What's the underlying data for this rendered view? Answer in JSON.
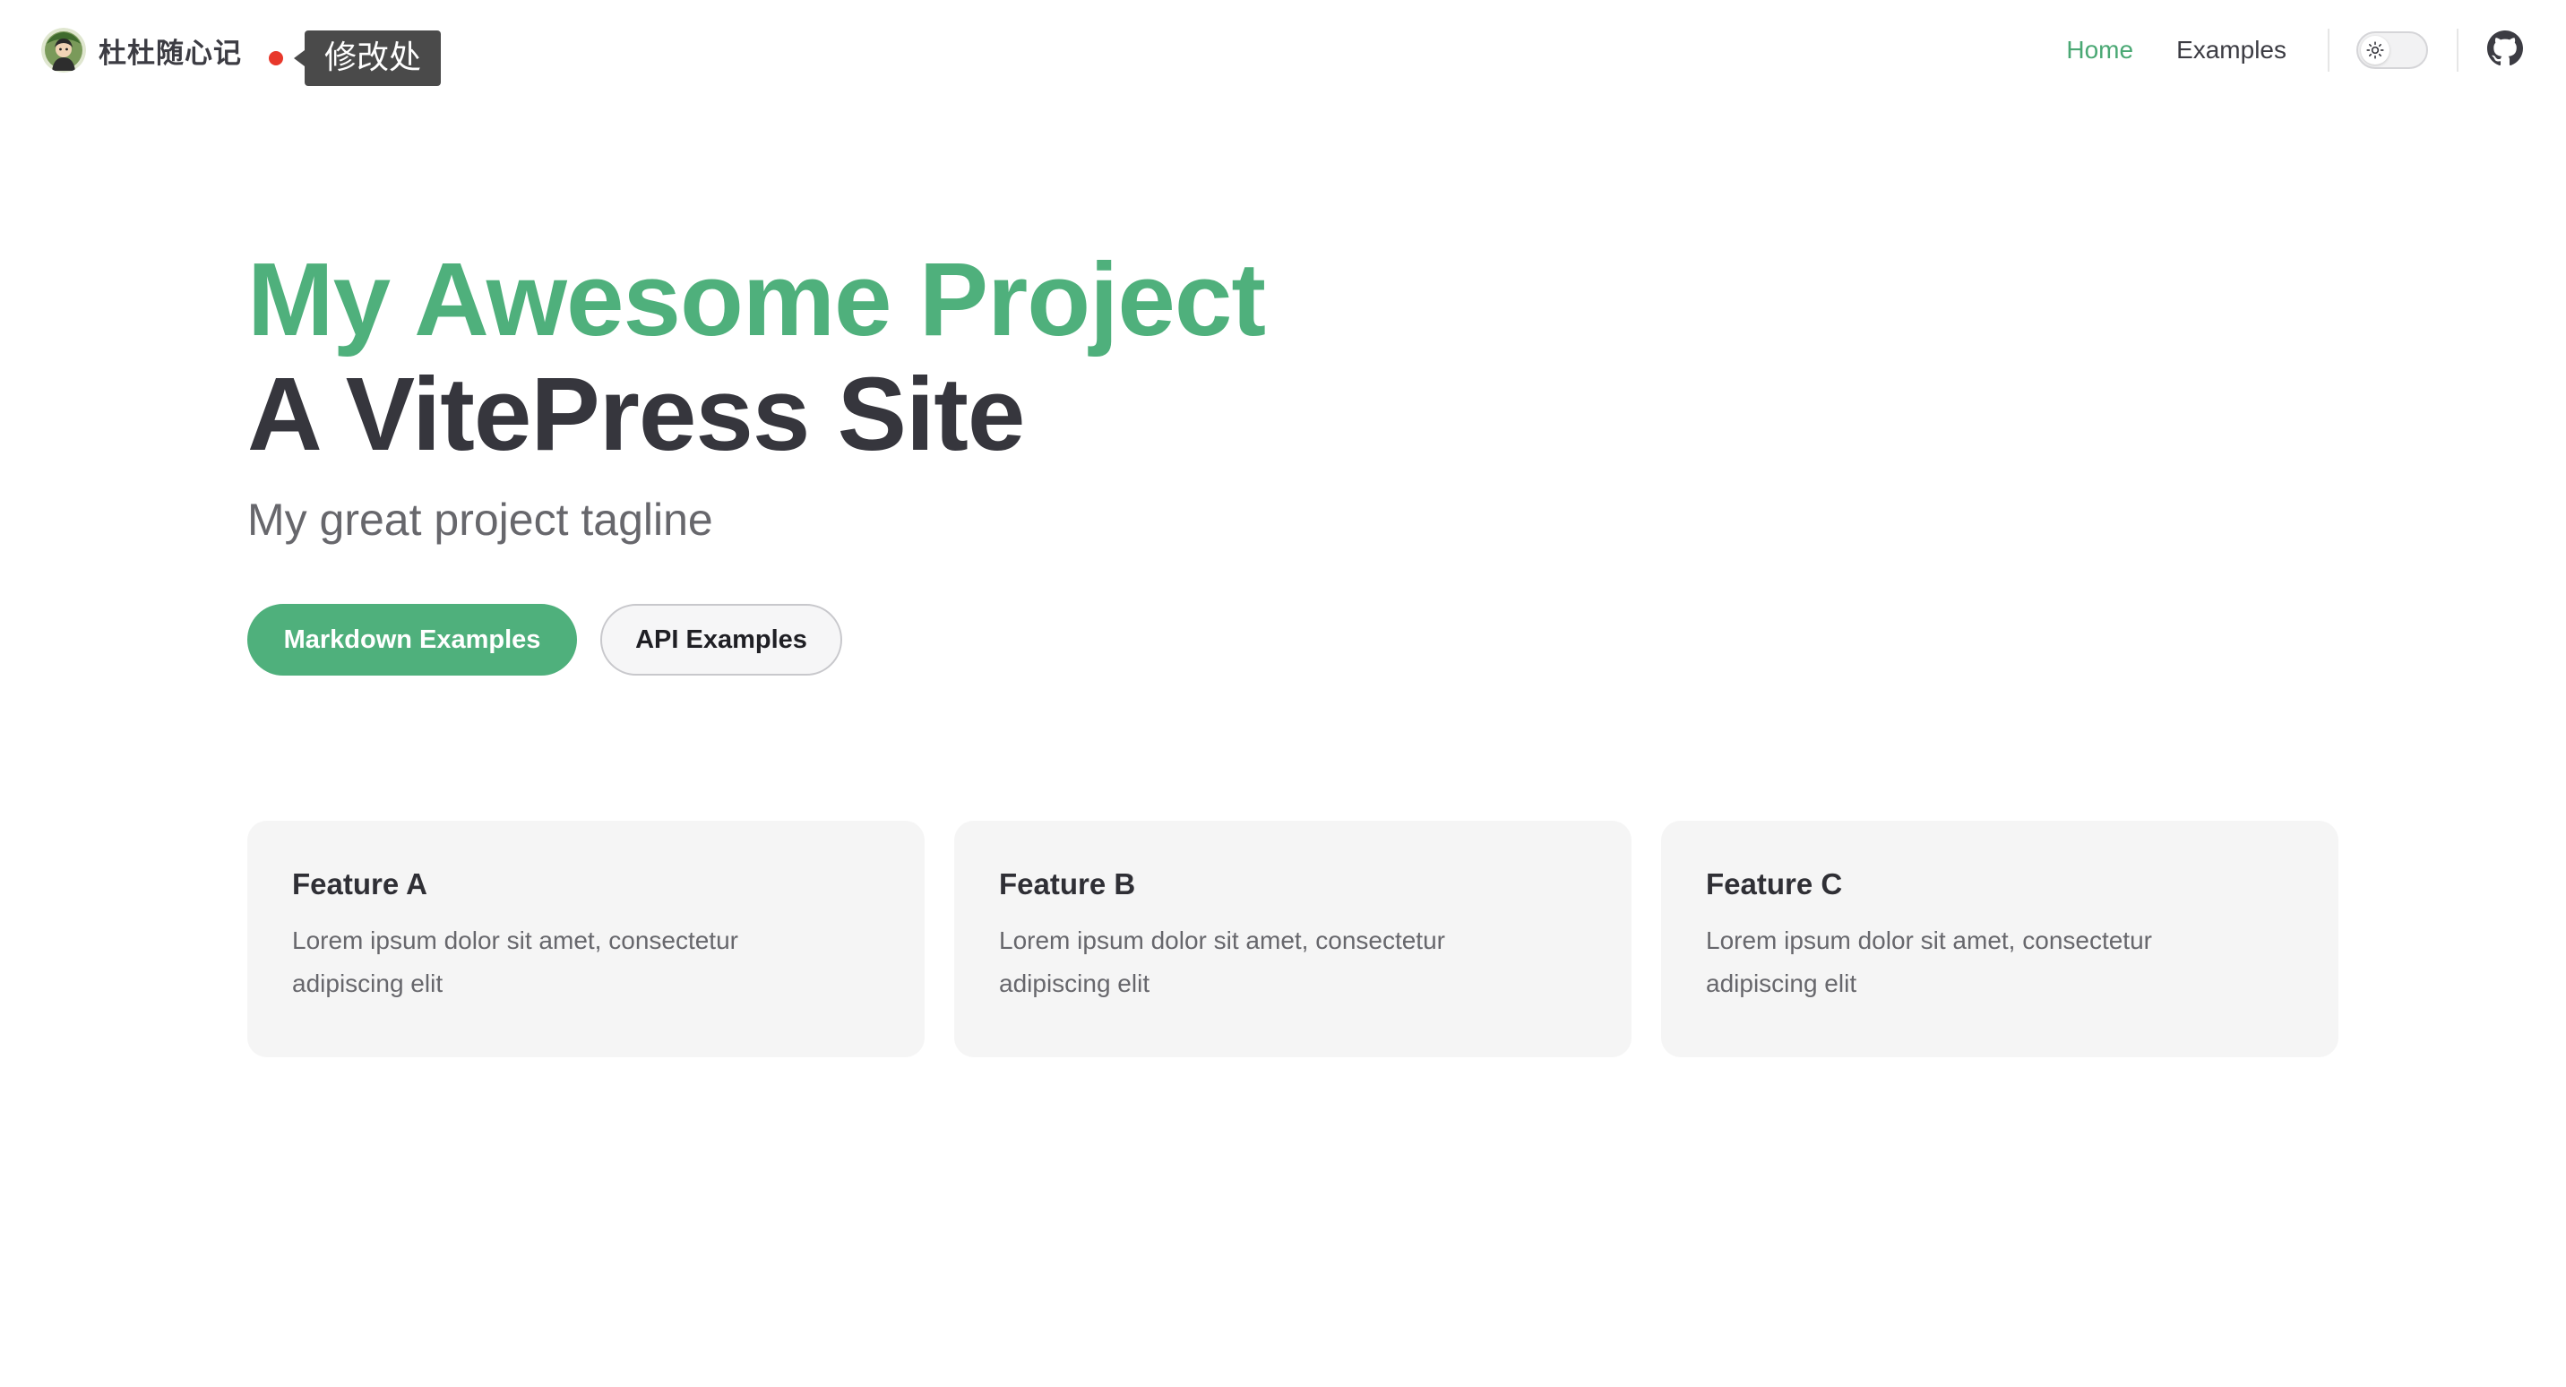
{
  "nav": {
    "site_title": "杜杜随心记",
    "annotation_label": "修改处",
    "links": [
      {
        "label": "Home",
        "active": true
      },
      {
        "label": "Examples",
        "active": false
      }
    ],
    "theme_toggle_icon": "sun-icon",
    "social_icon": "github-icon"
  },
  "hero": {
    "name": "My Awesome Project",
    "text": "A VitePress Site",
    "tagline": "My great project tagline",
    "actions": [
      {
        "label": "Markdown Examples",
        "theme": "brand"
      },
      {
        "label": "API Examples",
        "theme": "alt"
      }
    ]
  },
  "features": [
    {
      "title": "Feature A",
      "details": "Lorem ipsum dolor sit amet, consectetur adipiscing elit"
    },
    {
      "title": "Feature B",
      "details": "Lorem ipsum dolor sit amet, consectetur adipiscing elit"
    },
    {
      "title": "Feature C",
      "details": "Lorem ipsum dolor sit amet, consectetur adipiscing elit"
    }
  ],
  "colors": {
    "brand": "#4fb07c",
    "annotation_dot": "#e8382b",
    "annotation_bg": "#4a4a4a"
  }
}
